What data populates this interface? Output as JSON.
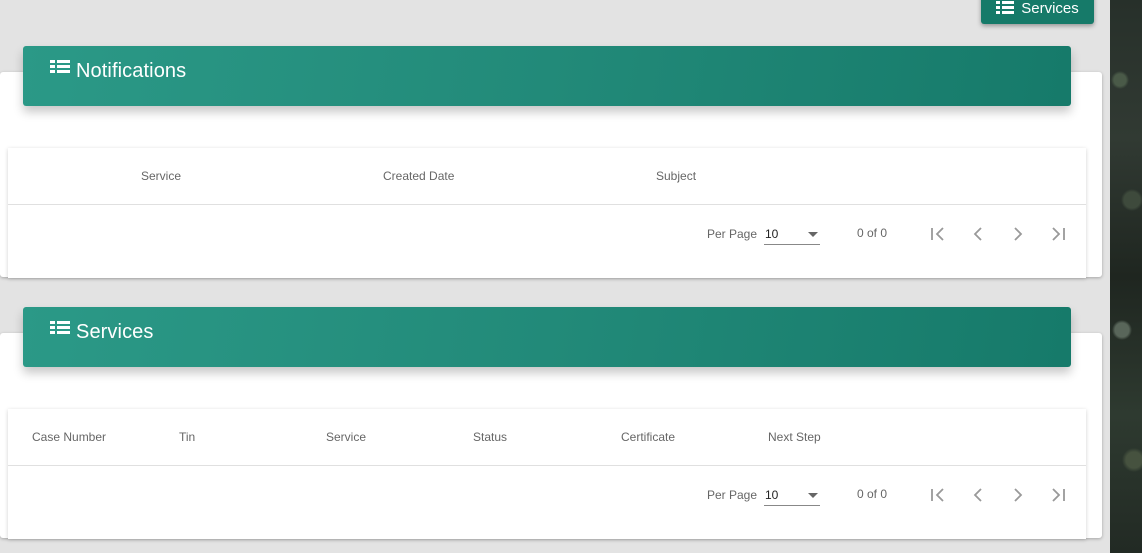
{
  "top_button": {
    "label": "Services",
    "icon": "list-icon"
  },
  "notifications": {
    "title": "Notifications",
    "icon": "list-icon",
    "columns": [
      "Service",
      "Created Date",
      "Subject"
    ],
    "rows": [],
    "pagination": {
      "per_page_label": "Per Page",
      "per_page_value": "10",
      "range_text": "0 of 0"
    }
  },
  "services": {
    "title": "Services",
    "icon": "list-icon",
    "columns": [
      "Case Number",
      "Tin",
      "Service",
      "Status",
      "Certificate",
      "Next Step"
    ],
    "rows": [],
    "pagination": {
      "per_page_label": "Per Page",
      "per_page_value": "10",
      "range_text": "0 of 0"
    }
  },
  "colors": {
    "header_start": "#2b9987",
    "header_end": "#167a6a",
    "page_background": "#e3e3e3",
    "card_background": "#ffffff"
  }
}
